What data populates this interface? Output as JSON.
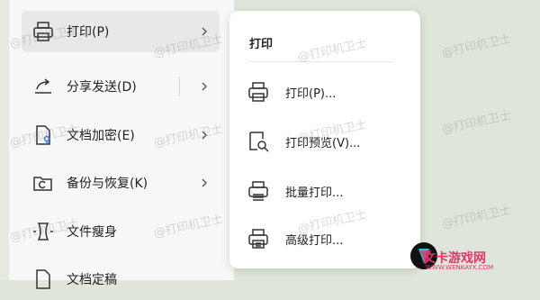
{
  "menu": {
    "items": [
      {
        "label": "打印(P)",
        "icon": "printer-icon",
        "active": true,
        "has_submenu": true
      },
      {
        "label": "分享发送(D)",
        "icon": "share-icon",
        "active": false,
        "has_submenu": true
      },
      {
        "label": "文档加密(E)",
        "icon": "encrypt-document-icon",
        "active": false,
        "has_submenu": true
      },
      {
        "label": "备份与恢复(K)",
        "icon": "backup-icon",
        "active": false,
        "has_submenu": true
      },
      {
        "label": "文件瘦身",
        "icon": "file-slim-icon",
        "active": false,
        "has_submenu": false
      },
      {
        "label": "文档定稿",
        "icon": "finalize-document-icon",
        "active": false,
        "has_submenu": false
      }
    ]
  },
  "submenu": {
    "title": "打印",
    "items": [
      {
        "label": "打印(P)...",
        "icon": "printer-icon"
      },
      {
        "label": "打印预览(V)...",
        "icon": "print-preview-icon"
      },
      {
        "label": "批量打印...",
        "icon": "batch-print-icon"
      },
      {
        "label": "高级打印...",
        "icon": "advanced-print-icon"
      }
    ]
  },
  "watermark": "@打印机卫士",
  "logo": {
    "text": "文卡游戏网",
    "subtext": "WWW.WENKAYX.COM"
  }
}
